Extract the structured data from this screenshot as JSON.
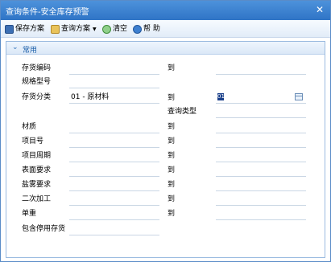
{
  "window": {
    "title": "查询条件-安全库存预警",
    "close_glyph": "✕"
  },
  "toolbar": {
    "save_scheme": "保存方案",
    "query_scheme": "查询方案",
    "clear": "清空",
    "help": "帮 助"
  },
  "section": {
    "title": "常用"
  },
  "fields": {
    "inventory_code": "存货编码",
    "to_1": "到",
    "spec": "规格型号",
    "category": "存货分类",
    "category_value": "01 - 原材料",
    "to_2": "到",
    "to_2_value": "01",
    "query_type": "查询类型",
    "material": "材质",
    "to_3": "到",
    "item_no": "项目号",
    "to_4": "到",
    "item_period": "项目周期",
    "to_5": "到",
    "surface": "表面要求",
    "to_6": "到",
    "salt_spray": "盐雾要求",
    "to_7": "到",
    "secondary": "二次加工",
    "to_8": "到",
    "unit_weight": "单重",
    "to_9": "到",
    "include_disabled": "包含停用存货"
  },
  "colors": {
    "titlebar": "#2f74c6",
    "section_text": "#1b5ea8",
    "underline": "#c9d6e4"
  }
}
